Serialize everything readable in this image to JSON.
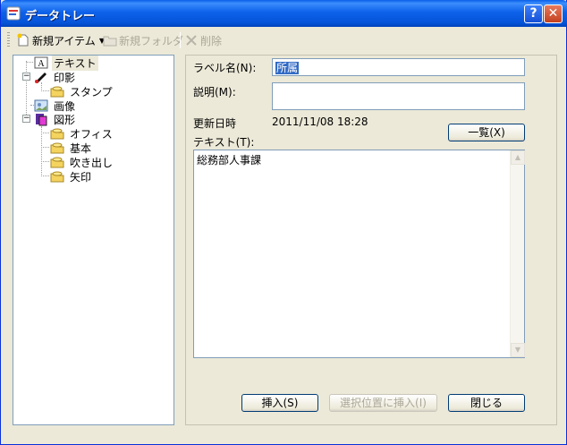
{
  "window": {
    "title": "データトレー",
    "help_button": "?",
    "close_button": "✕"
  },
  "toolbar": {
    "new_item": "新規アイテム",
    "new_folder": "新規フォルダ",
    "delete": "削除"
  },
  "tree": {
    "items": [
      {
        "label": "テキスト",
        "icon": "text-icon"
      },
      {
        "label": "印影",
        "icon": "seal-icon"
      },
      {
        "label": "スタンプ",
        "icon": "folder-icon"
      },
      {
        "label": "画像",
        "icon": "image-icon"
      },
      {
        "label": "図形",
        "icon": "shape-icon"
      },
      {
        "label": "オフィス",
        "icon": "folder-icon"
      },
      {
        "label": "基本",
        "icon": "folder-icon"
      },
      {
        "label": "吹き出し",
        "icon": "folder-icon"
      },
      {
        "label": "矢印",
        "icon": "folder-icon"
      }
    ]
  },
  "form": {
    "label_name_label": "ラベル名(N):",
    "label_name_value": "所属",
    "description_label": "説明(M):",
    "description_value": "",
    "updated_label": "更新日時",
    "updated_value": "2011/11/08 18:28",
    "text_label": "テキスト(T):",
    "list_button": "一覧(X)",
    "text_value": "総務部人事課"
  },
  "buttons": {
    "insert": "挿入(S)",
    "insert_at_selection": "選択位置に挿入(I)",
    "close": "閉じる"
  },
  "colors": {
    "titlebar": "#0654d9",
    "window_bg": "#ece9d8",
    "selection": "#316ac5"
  }
}
